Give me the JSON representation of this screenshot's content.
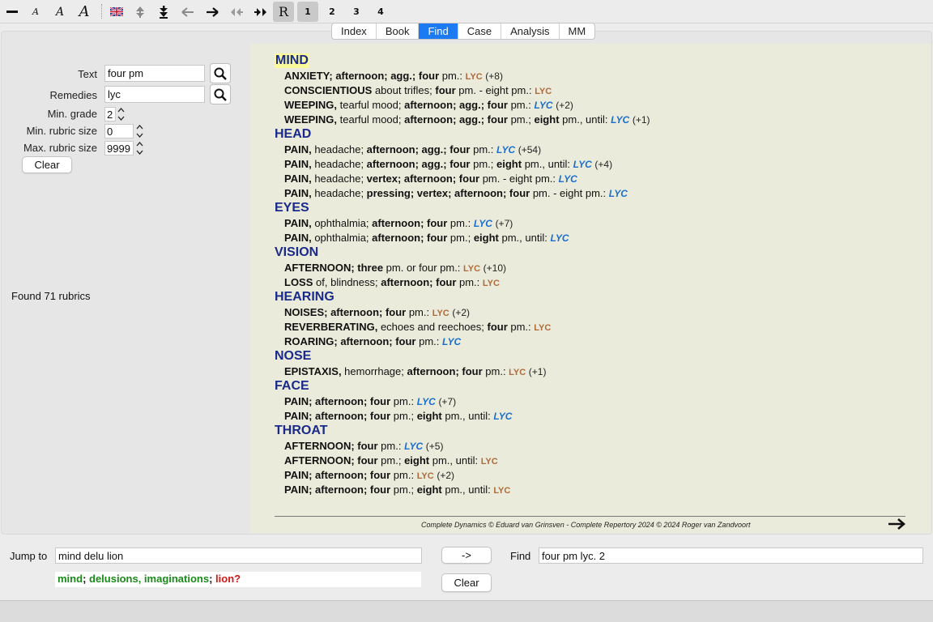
{
  "toolbar": {
    "numbers": [
      "1",
      "2",
      "3",
      "4"
    ],
    "r_label": "R"
  },
  "tabs": [
    "Index",
    "Book",
    "Find",
    "Case",
    "Analysis",
    "MM"
  ],
  "active_tab": "Find",
  "search": {
    "text_label": "Text",
    "text_value": "four pm",
    "remedies_label": "Remedies",
    "remedies_value": "lyc",
    "min_grade_label": "Min. grade",
    "min_grade_value": "2",
    "min_rubric_label": "Min. rubric size",
    "min_rubric_value": "0",
    "max_rubric_label": "Max. rubric size",
    "max_rubric_value": "9999",
    "clear_label": "Clear"
  },
  "found_text": "Found 71 rubrics",
  "chapters": [
    {
      "name": "MIND",
      "rubrics": [
        {
          "parts": [
            [
              "b",
              "ANXIETY; afternoon; agg.; four"
            ],
            [
              "n",
              " pm.: "
            ]
          ],
          "rem": "LYC",
          "grade": 2,
          "count": "(+8)"
        },
        {
          "parts": [
            [
              "b",
              "CONSCIENTIOUS"
            ],
            [
              "n",
              " about trifles; "
            ],
            [
              "b",
              "four"
            ],
            [
              "n",
              " pm. - eight pm.: "
            ]
          ],
          "rem": "LYC",
          "grade": 2,
          "count": ""
        },
        {
          "parts": [
            [
              "b",
              "WEEPING,"
            ],
            [
              "n",
              " tearful mood; "
            ],
            [
              "b",
              "afternoon; agg.; four"
            ],
            [
              "n",
              " pm.: "
            ]
          ],
          "rem": "LYC",
          "grade": 3,
          "count": "(+2)"
        },
        {
          "parts": [
            [
              "b",
              "WEEPING,"
            ],
            [
              "n",
              " tearful mood; "
            ],
            [
              "b",
              "afternoon; agg.; four"
            ],
            [
              "n",
              " pm.; "
            ],
            [
              "b",
              "eight"
            ],
            [
              "n",
              " pm., until: "
            ]
          ],
          "rem": "LYC",
          "grade": 3,
          "count": "(+1)"
        }
      ]
    },
    {
      "name": "HEAD",
      "rubrics": [
        {
          "parts": [
            [
              "b",
              "PAIN,"
            ],
            [
              "n",
              " headache; "
            ],
            [
              "b",
              "afternoon; agg.; four"
            ],
            [
              "n",
              " pm.: "
            ]
          ],
          "rem": "LYC",
          "grade": 3,
          "count": "(+54)"
        },
        {
          "parts": [
            [
              "b",
              "PAIN,"
            ],
            [
              "n",
              " headache; "
            ],
            [
              "b",
              "afternoon; agg.; four"
            ],
            [
              "n",
              " pm.; "
            ],
            [
              "b",
              "eight"
            ],
            [
              "n",
              " pm., until: "
            ]
          ],
          "rem": "LYC",
          "grade": 3,
          "count": "(+4)"
        },
        {
          "parts": [
            [
              "b",
              "PAIN,"
            ],
            [
              "n",
              " headache; "
            ],
            [
              "b",
              "vertex; afternoon; four"
            ],
            [
              "n",
              " pm. - eight pm.: "
            ]
          ],
          "rem": "LYC",
          "grade": 3,
          "count": ""
        },
        {
          "parts": [
            [
              "b",
              "PAIN,"
            ],
            [
              "n",
              " headache; "
            ],
            [
              "b",
              "pressing; vertex; afternoon; four"
            ],
            [
              "n",
              " pm. - eight pm.: "
            ]
          ],
          "rem": "LYC",
          "grade": 3,
          "count": ""
        }
      ]
    },
    {
      "name": "EYES",
      "rubrics": [
        {
          "parts": [
            [
              "b",
              "PAIN,"
            ],
            [
              "n",
              " ophthalmia; "
            ],
            [
              "b",
              "afternoon; four"
            ],
            [
              "n",
              " pm.: "
            ]
          ],
          "rem": "LYC",
          "grade": 3,
          "count": "(+7)"
        },
        {
          "parts": [
            [
              "b",
              "PAIN,"
            ],
            [
              "n",
              " ophthalmia; "
            ],
            [
              "b",
              "afternoon; four"
            ],
            [
              "n",
              " pm.; "
            ],
            [
              "b",
              "eight"
            ],
            [
              "n",
              " pm., until: "
            ]
          ],
          "rem": "LYC",
          "grade": 3,
          "count": ""
        }
      ]
    },
    {
      "name": "VISION",
      "rubrics": [
        {
          "parts": [
            [
              "b",
              "AFTERNOON; three"
            ],
            [
              "n",
              " pm. or four pm.: "
            ]
          ],
          "rem": "LYC",
          "grade": 2,
          "count": "(+10)"
        },
        {
          "parts": [
            [
              "b",
              "LOSS"
            ],
            [
              "n",
              " of, blindness; "
            ],
            [
              "b",
              "afternoon; four"
            ],
            [
              "n",
              " pm.: "
            ]
          ],
          "rem": "LYC",
          "grade": 2,
          "count": ""
        }
      ]
    },
    {
      "name": "HEARING",
      "rubrics": [
        {
          "parts": [
            [
              "b",
              "NOISES; afternoon; four"
            ],
            [
              "n",
              " pm.: "
            ]
          ],
          "rem": "LYC",
          "grade": 2,
          "count": "(+2)"
        },
        {
          "parts": [
            [
              "b",
              "REVERBERATING,"
            ],
            [
              "n",
              " echoes and reechoes; "
            ],
            [
              "b",
              "four"
            ],
            [
              "n",
              " pm.: "
            ]
          ],
          "rem": "LYC",
          "grade": 2,
          "count": ""
        },
        {
          "parts": [
            [
              "b",
              "ROARING; afternoon; four"
            ],
            [
              "n",
              " pm.: "
            ]
          ],
          "rem": "LYC",
          "grade": 3,
          "count": ""
        }
      ]
    },
    {
      "name": "NOSE",
      "rubrics": [
        {
          "parts": [
            [
              "b",
              "EPISTAXIS,"
            ],
            [
              "n",
              " hemorrhage; "
            ],
            [
              "b",
              "afternoon; four"
            ],
            [
              "n",
              " pm.: "
            ]
          ],
          "rem": "LYC",
          "grade": 2,
          "count": "(+1)"
        }
      ]
    },
    {
      "name": "FACE",
      "rubrics": [
        {
          "parts": [
            [
              "b",
              "PAIN; afternoon; four"
            ],
            [
              "n",
              " pm.: "
            ]
          ],
          "rem": "LYC",
          "grade": 3,
          "count": "(+7)"
        },
        {
          "parts": [
            [
              "b",
              "PAIN; afternoon; four"
            ],
            [
              "n",
              " pm.; "
            ],
            [
              "b",
              "eight"
            ],
            [
              "n",
              " pm., until: "
            ]
          ],
          "rem": "LYC",
          "grade": 3,
          "count": ""
        }
      ]
    },
    {
      "name": "THROAT",
      "rubrics": [
        {
          "parts": [
            [
              "b",
              "AFTERNOON; four"
            ],
            [
              "n",
              " pm.: "
            ]
          ],
          "rem": "LYC",
          "grade": 3,
          "count": "(+5)"
        },
        {
          "parts": [
            [
              "b",
              "AFTERNOON; four"
            ],
            [
              "n",
              " pm.; "
            ],
            [
              "b",
              "eight"
            ],
            [
              "n",
              " pm., until: "
            ]
          ],
          "rem": "LYC",
          "grade": 2,
          "count": ""
        },
        {
          "parts": [
            [
              "b",
              "PAIN; afternoon; four"
            ],
            [
              "n",
              " pm.: "
            ]
          ],
          "rem": "LYC",
          "grade": 2,
          "count": "(+2)"
        },
        {
          "parts": [
            [
              "b",
              "PAIN; afternoon; four"
            ],
            [
              "n",
              " pm.; "
            ],
            [
              "b",
              "eight"
            ],
            [
              "n",
              " pm., until: "
            ]
          ],
          "rem": "LYC",
          "grade": 2,
          "count": ""
        }
      ]
    }
  ],
  "footer_text": "Complete Dynamics © Eduard van Grinsven   -   Complete Repertory 2024 © 2024 Roger van Zandvoort",
  "bottom": {
    "jump_label": "Jump to",
    "jump_value": "mind delu lion",
    "jump_button": "->",
    "find_label": "Find",
    "find_value": "four pm lyc. 2",
    "clear_label": "Clear",
    "jump_result": {
      "part1": "mind",
      "sep1": "; ",
      "part2": "delusions, imaginations",
      "sep2": "; ",
      "part3": "lion?"
    }
  },
  "colors": {
    "chapter": "#1a2a8a",
    "grade2": "#b06a3a",
    "grade3": "#1a6fcf",
    "active_tab": "#1c7bf2",
    "content_bg": "#ebebdc"
  }
}
